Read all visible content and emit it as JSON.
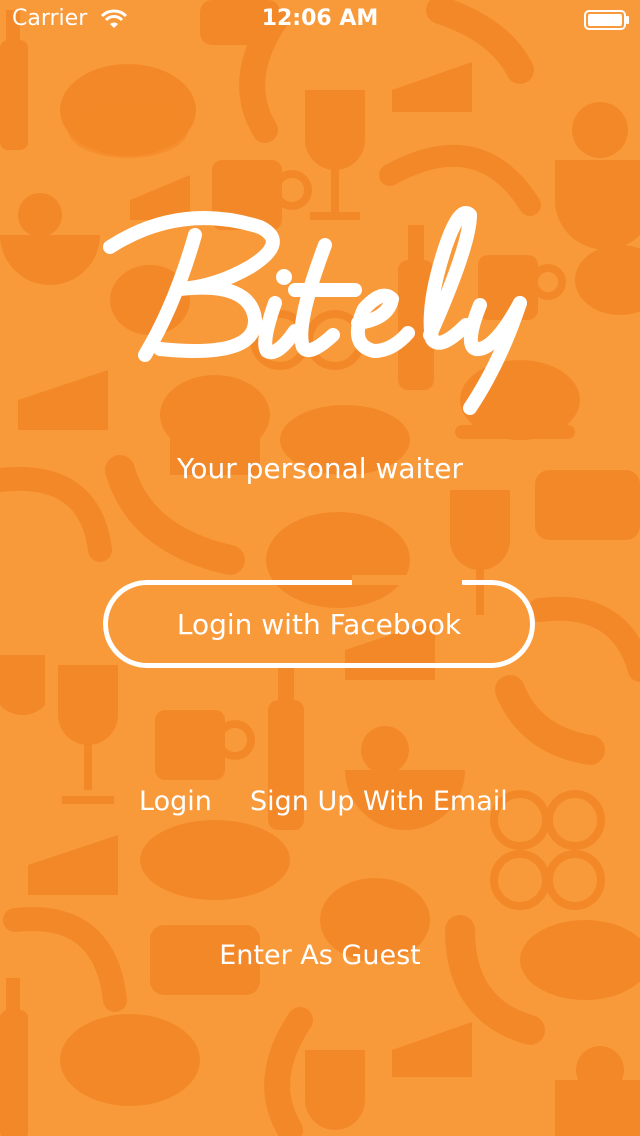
{
  "status_bar": {
    "carrier": "Carrier",
    "time": "12:06 AM",
    "wifi_icon": "wifi-icon",
    "battery_icon": "battery-icon"
  },
  "brand": {
    "logo_text": "Bitely",
    "tagline": "Your personal waiter"
  },
  "actions": {
    "facebook_login": "Login with Facebook",
    "login": "Login",
    "signup_email": "Sign Up With Email",
    "guest": "Enter As Guest"
  },
  "colors": {
    "background": "#f99a3a",
    "pattern": "#f07a18",
    "text": "#ffffff"
  },
  "background_icons": [
    "meat-icon",
    "sausage-icon",
    "wine-glass-icon",
    "cheese-icon",
    "shrimp-icon",
    "salad-bowl-icon",
    "beer-bottle-icon",
    "coffee-cup-icon",
    "muffin-icon",
    "croissant-icon",
    "sushi-icon",
    "chicken-icon"
  ]
}
